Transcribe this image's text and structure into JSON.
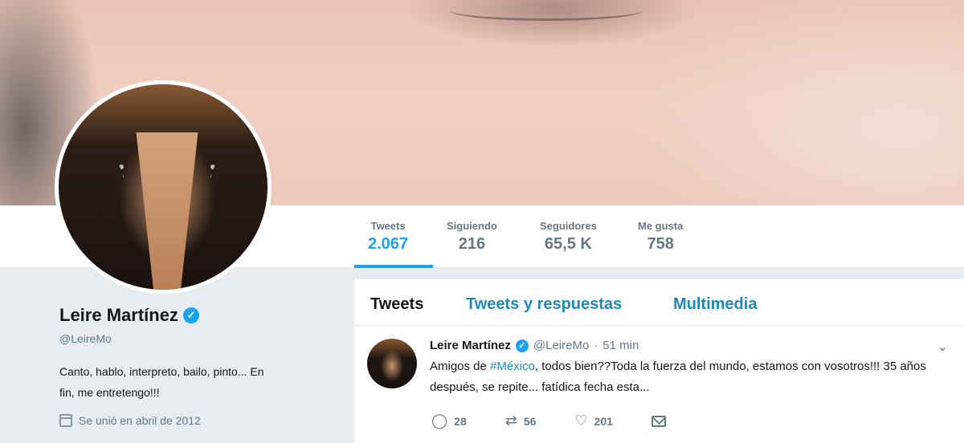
{
  "profile": {
    "name": "Leire Martínez",
    "handle": "@LeireMo",
    "bio_line1": "Canto, hablo, interpreto, bailo, pinto... En",
    "bio_line2": "fin, me entretengo!!!",
    "joined": "Se unió en abril de 2012",
    "verified_icon": "✓"
  },
  "stats": [
    {
      "label": "Tweets",
      "value": "2.067"
    },
    {
      "label": "Siguiendo",
      "value": "216"
    },
    {
      "label": "Seguidores",
      "value": "65,5 K"
    },
    {
      "label": "Me gusta",
      "value": "758"
    }
  ],
  "tabs": [
    "Tweets",
    "Tweets y respuestas",
    "Multimedia"
  ],
  "tweet": {
    "name": "Leire Martínez",
    "verified_icon": "✓",
    "handle": "@LeireMo",
    "separator": "·",
    "time": "51 min",
    "chevron": "⌄",
    "text_before": "Amigos de ",
    "hashtag": "#México",
    "text_after": ", todos bien??Toda la fuerza del mundo, estamos con vosotros!!! 35 años después, se repite... fatídica fecha esta...",
    "reply_icon": "◯",
    "replies": "28",
    "retweet_icon": "⇄",
    "retweets": "56",
    "like_icon": "♡",
    "likes": "201"
  },
  "colors": {
    "accent": "#1da1f2",
    "link": "#1d8bb3",
    "muted": "#657786",
    "background": "#e6ecf0"
  }
}
